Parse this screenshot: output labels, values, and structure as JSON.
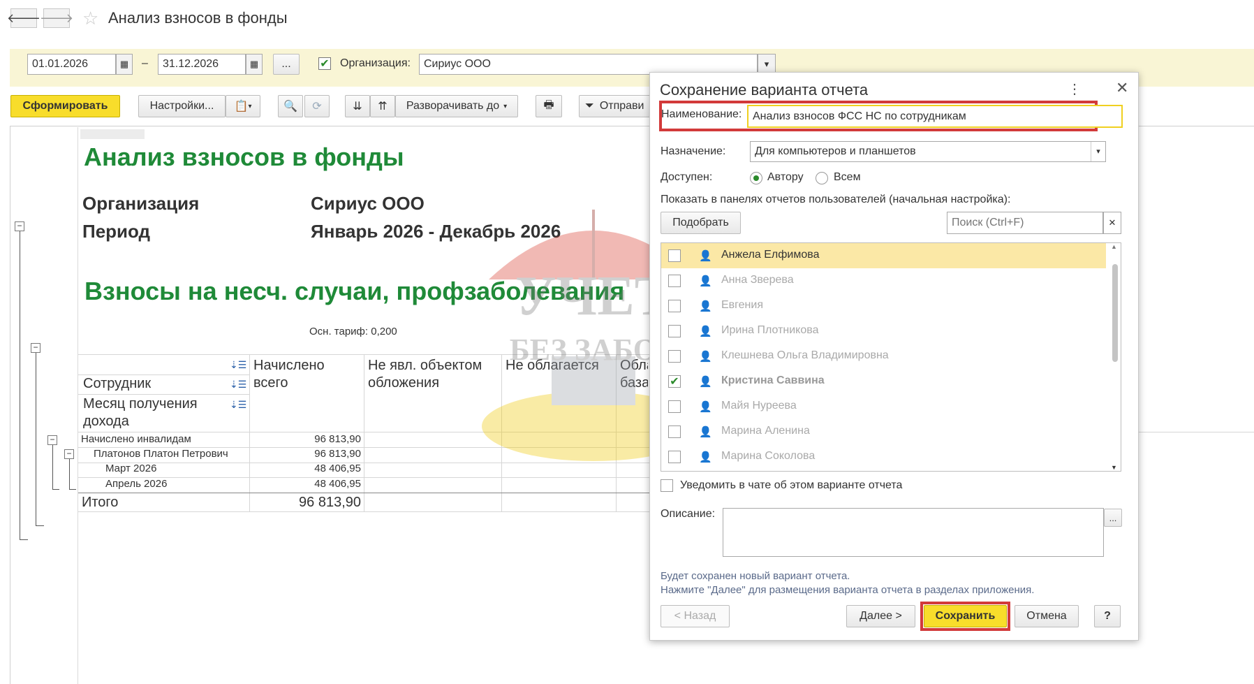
{
  "window": {
    "title": "Анализ взносов в фонды",
    "back_icon": "arrow-left-icon",
    "forward_icon": "arrow-right-icon",
    "favorite_icon": "star-icon"
  },
  "filters": {
    "date_from": "01.01.2026",
    "dash": "–",
    "date_to": "31.12.2026",
    "period_button": "...",
    "org_checked": true,
    "org_label": "Организация:",
    "org_value": "Сириус ООО"
  },
  "toolbar": {
    "generate": "Сформировать",
    "settings": "Настройки...",
    "expand_to": "Разворачивать до",
    "send": "Отправи"
  },
  "report": {
    "title": "Анализ взносов в фонды",
    "org_label": "Организация",
    "org_value": "Сириус ООО",
    "period_label": "Период",
    "period_value": "Январь 2026 - Декабрь 2026",
    "section_title": "Взносы на несч. случаи, профзаболевания",
    "tariff": "Осн. тариф: 0,200",
    "col_employee": "Сотрудник",
    "col_month": "Месяц получения дохода",
    "col_accrued": "Начислено всего",
    "col_not_object": "Не явл. объектом обложения",
    "col_not_taxed": "Не облагается",
    "col_base": "Обла база",
    "rows": [
      {
        "label": "Начислено инвалидам",
        "value": "96 813,90"
      },
      {
        "label": "Платонов Платон Петрович",
        "value": "96 813,90"
      },
      {
        "label": "Март 2026",
        "value": "48 406,95"
      },
      {
        "label": "Апрель 2026",
        "value": "48 406,95"
      }
    ],
    "total_label": "Итого",
    "total_value": "96 813,90"
  },
  "dialog": {
    "title": "Сохранение варианта отчета",
    "name_label": "Наименование:",
    "name_value": "Анализ взносов ФСС НС по сотрудникам",
    "purpose_label": "Назначение:",
    "purpose_value": "Для компьютеров и планшетов",
    "available_label": "Доступен:",
    "author_option": "Автору",
    "all_option": "Всем",
    "panels_label": "Показать в панелях отчетов пользователей (начальная настройка):",
    "pick_button": "Подобрать",
    "search_placeholder": "Поиск (Ctrl+F)",
    "users": [
      {
        "name": "Анжела Елфимова",
        "checked": false,
        "selected": true
      },
      {
        "name": "Анна Зверева",
        "checked": false,
        "selected": false
      },
      {
        "name": "Евгения",
        "checked": false,
        "selected": false
      },
      {
        "name": "Ирина Плотникова",
        "checked": false,
        "selected": false
      },
      {
        "name": "Клешнева Ольга Владимировна",
        "checked": false,
        "selected": false
      },
      {
        "name": "Кристина Саввина",
        "checked": true,
        "selected": false
      },
      {
        "name": "Майя Нуреева",
        "checked": false,
        "selected": false
      },
      {
        "name": "Марина Аленина",
        "checked": false,
        "selected": false
      },
      {
        "name": "Марина Соколова",
        "checked": false,
        "selected": false
      }
    ],
    "notify_label": "Уведомить в чате об этом варианте отчета",
    "description_label": "Описание:",
    "description_value": "",
    "info_line1": "Будет сохранен новый вариант отчета.",
    "info_line2": "Нажмите \"Далее\" для размещения варианта отчета в разделах приложения.",
    "back_button": "< Назад",
    "next_button": "Далее >",
    "save_button": "Сохранить",
    "cancel_button": "Отмена",
    "help_button": "?"
  },
  "colors": {
    "report_green": "#1f8a38",
    "highlight_red": "#d23a3a",
    "primary_yellow": "#f8dd2b",
    "filter_band": "#f9f5d5",
    "selected_row": "#fbe8a6"
  }
}
